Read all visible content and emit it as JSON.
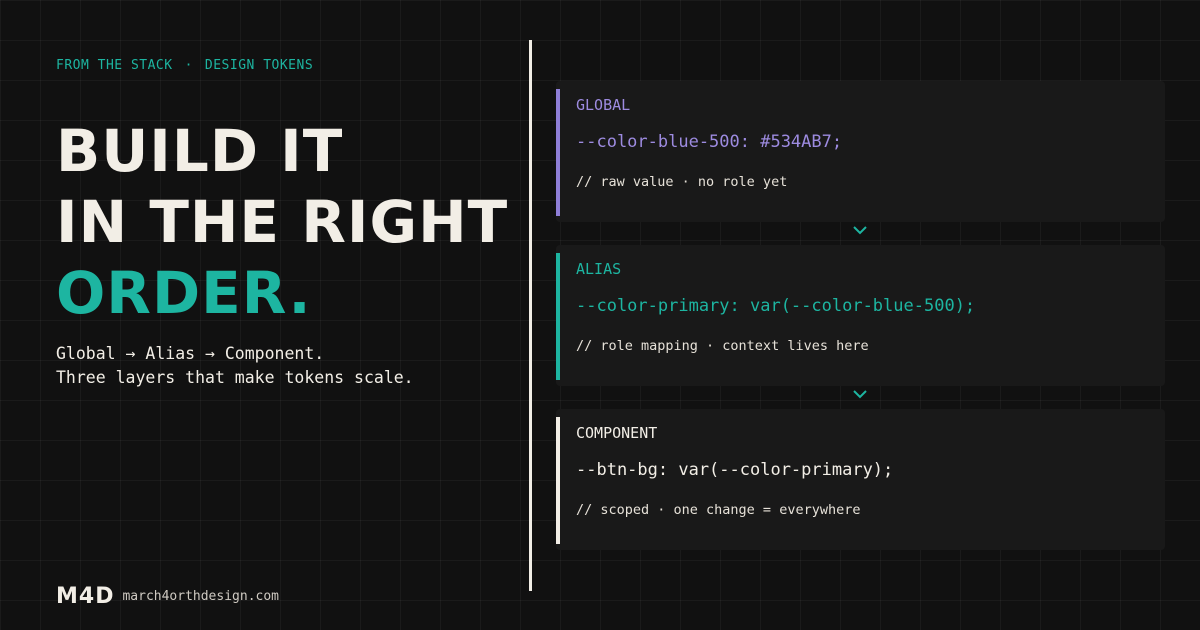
{
  "kicker": {
    "left": "FROM THE STACK",
    "separator": "·",
    "right": "DESIGN TOKENS"
  },
  "headline": {
    "line1": "BUILD IT",
    "line2": "IN THE RIGHT",
    "line3": "ORDER."
  },
  "subtitle": {
    "line1": "Global → Alias → Component.",
    "line2": "Three layers that make tokens scale."
  },
  "footer": {
    "logo": "M4D",
    "site": "march4orthdesign.com"
  },
  "cards": [
    {
      "label": "GLOBAL",
      "code": "--color-blue-500: #534AB7;",
      "note": "// raw value · no role yet"
    },
    {
      "label": "ALIAS",
      "code": "--color-primary: var(--color-blue-500);",
      "note": "// role mapping · context lives here"
    },
    {
      "label": "COMPONENT",
      "code": "--btn-bg: var(--color-primary);",
      "note": "// scoped · one change = everywhere"
    }
  ],
  "icons": {
    "connector": "chevron-down-icon"
  },
  "colors": {
    "accent": "#1db5a1",
    "global": "#8f7fd8",
    "component": "#f2eee6",
    "background": "#111111"
  }
}
